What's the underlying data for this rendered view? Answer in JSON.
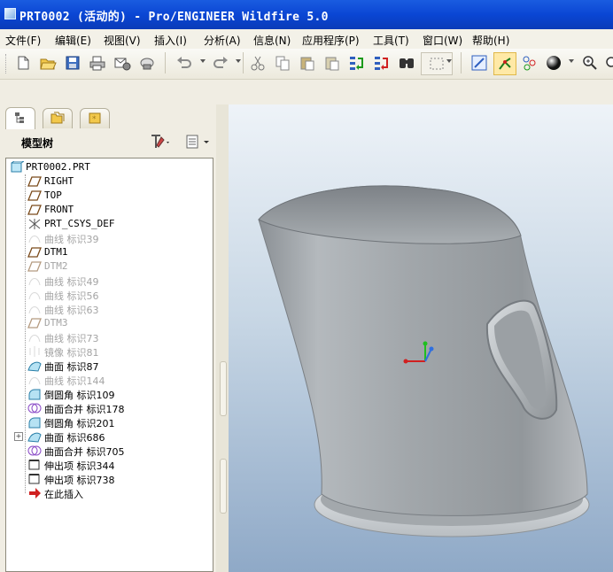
{
  "window": {
    "title": "PRT0002 (活动的) - Pro/ENGINEER Wildfire 5.0"
  },
  "menu": [
    "文件(F)",
    "编辑(E)",
    "视图(V)",
    "插入(I)",
    "分析(A)",
    "信息(N)",
    "应用程序(P)",
    "工具(T)",
    "窗口(W)",
    "帮助(H)"
  ],
  "toolbar": {
    "icons": [
      "new-icon",
      "open-icon",
      "save-icon",
      "print-icon",
      "send-mail-icon",
      "send-icon",
      "undo-icon",
      "redo-icon",
      "cut-icon",
      "copy-icon",
      "paste-icon",
      "paste-special-icon",
      "regenerate-icon",
      "regen-manager-icon",
      "find-icon",
      "select-box-icon",
      "repaint-icon",
      "spin-center-icon",
      "orient-mode-icon",
      "shading-icon",
      "zoom-in-icon"
    ]
  },
  "model_tree": {
    "title": "模型树",
    "items": [
      {
        "label": "PRT0002.PRT",
        "icon": "part-icon",
        "dim": false
      },
      {
        "label": "RIGHT",
        "icon": "datum-plane-icon",
        "dim": false
      },
      {
        "label": "TOP",
        "icon": "datum-plane-icon",
        "dim": false
      },
      {
        "label": "FRONT",
        "icon": "datum-plane-icon",
        "dim": false
      },
      {
        "label": "PRT_CSYS_DEF",
        "icon": "csys-icon",
        "dim": false
      },
      {
        "label": "曲线 标识39",
        "icon": "curve-icon",
        "dim": true
      },
      {
        "label": "DTM1",
        "icon": "datum-plane-icon",
        "dim": false
      },
      {
        "label": "DTM2",
        "icon": "datum-plane-icon",
        "dim": true
      },
      {
        "label": "曲线 标识49",
        "icon": "curve-icon",
        "dim": true
      },
      {
        "label": "曲线 标识56",
        "icon": "curve-icon",
        "dim": true
      },
      {
        "label": "曲线 标识63",
        "icon": "curve-icon",
        "dim": true
      },
      {
        "label": "DTM3",
        "icon": "datum-plane-icon",
        "dim": true
      },
      {
        "label": "曲线 标识73",
        "icon": "curve-icon",
        "dim": true
      },
      {
        "label": "镜像 标识81",
        "icon": "mirror-icon",
        "dim": true
      },
      {
        "label": "曲面 标识87",
        "icon": "surface-icon",
        "dim": false
      },
      {
        "label": "曲线 标识144",
        "icon": "curve-icon",
        "dim": true
      },
      {
        "label": "倒圆角 标识109",
        "icon": "round-icon",
        "dim": false
      },
      {
        "label": "曲面合并 标识178",
        "icon": "merge-icon",
        "dim": false
      },
      {
        "label": "倒圆角 标识201",
        "icon": "round-icon",
        "dim": false
      },
      {
        "label": "曲面 标识686",
        "icon": "surface-icon",
        "dim": false
      },
      {
        "label": "曲面合并 标识705",
        "icon": "merge-icon",
        "dim": false
      },
      {
        "label": "伸出项 标识344",
        "icon": "protrusion-icon",
        "dim": false
      },
      {
        "label": "伸出项 标识738",
        "icon": "protrusion-icon",
        "dim": false
      },
      {
        "label": "在此插入",
        "icon": "insert-here-icon",
        "dim": false
      }
    ]
  },
  "colors": {
    "titlebar": "#0a46d4",
    "model": "#a7acb0",
    "viewport_top": "#eef3f8",
    "viewport_bottom": "#8fa9c7"
  }
}
